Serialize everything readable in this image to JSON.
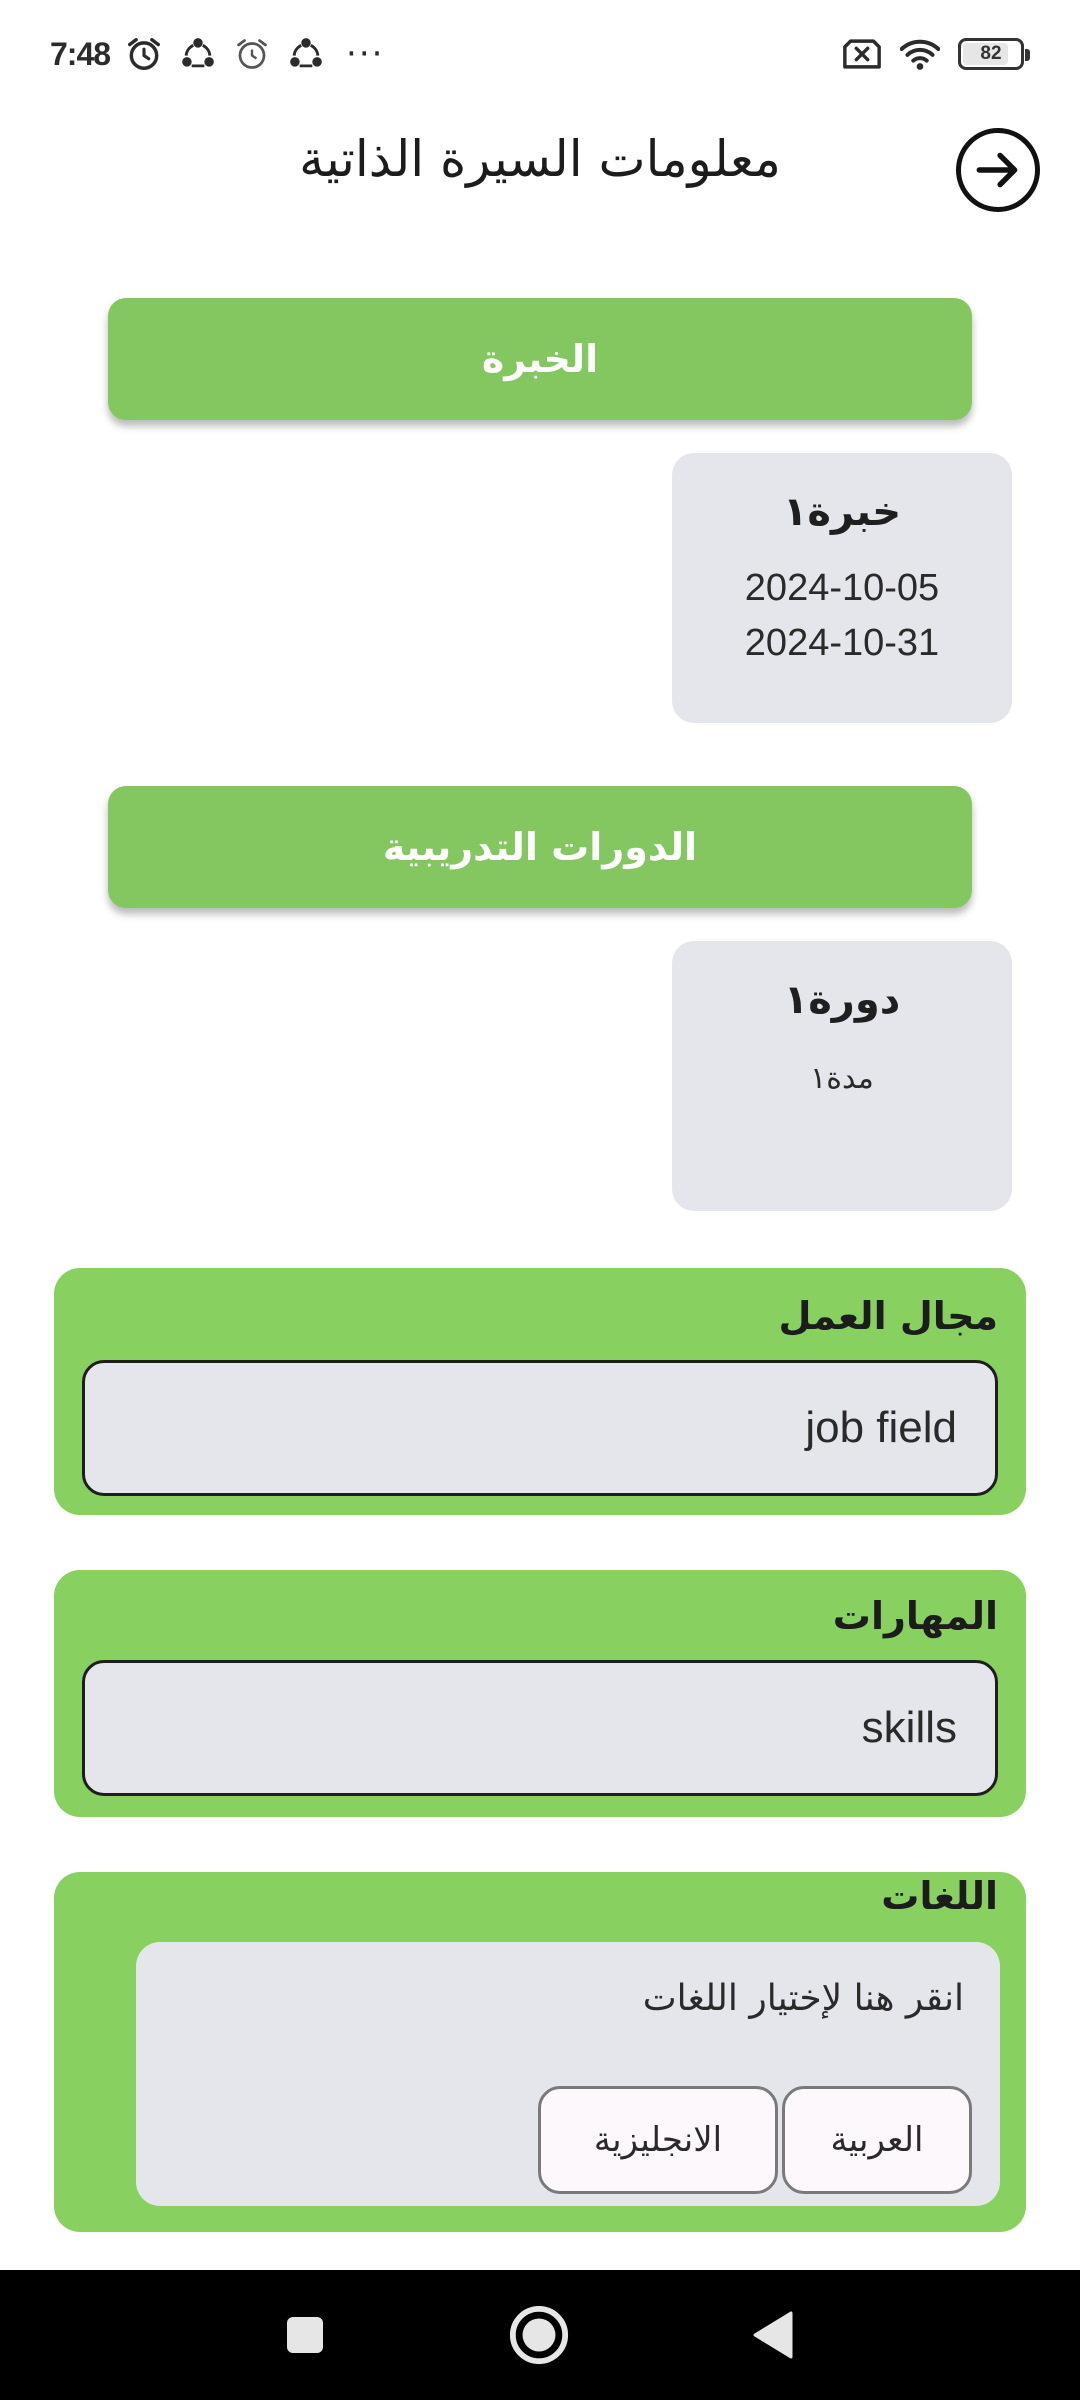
{
  "status_bar": {
    "time": "7:48",
    "battery": "82",
    "battery_level": 0.82,
    "icons": [
      "alarm-icon",
      "share-icon",
      "alarm-icon",
      "share-icon",
      "more-dots-icon",
      "no-sim-icon",
      "wifi-icon",
      "battery-icon"
    ]
  },
  "header": {
    "title": "معلومات السيرة الذاتية",
    "back_icon": "arrow-right-circle-icon"
  },
  "experience": {
    "button_label": "الخبرة",
    "items": [
      {
        "title": "خبرة١",
        "start_date": "2024-10-05",
        "end_date": "2024-10-31"
      }
    ]
  },
  "courses": {
    "button_label": "الدورات التدريبية",
    "items": [
      {
        "title": "دورة١",
        "duration": "مدة١"
      }
    ]
  },
  "job_field": {
    "label": "مجال العمل",
    "value": "job field"
  },
  "skills": {
    "label": "المهارات",
    "value": "skills"
  },
  "languages": {
    "label": "اللغات",
    "hint": "انقر هنا لإختيار اللغات",
    "chips": [
      "العربية",
      "الانجليزية"
    ]
  },
  "colors": {
    "accent_green": "#84c660",
    "panel_green": "#88d160",
    "card_gray": "#e4e6ec",
    "nav_black": "#000000"
  },
  "nav_bar": {
    "icons": [
      "recents-square-icon",
      "home-circle-icon",
      "back-triangle-icon"
    ]
  }
}
